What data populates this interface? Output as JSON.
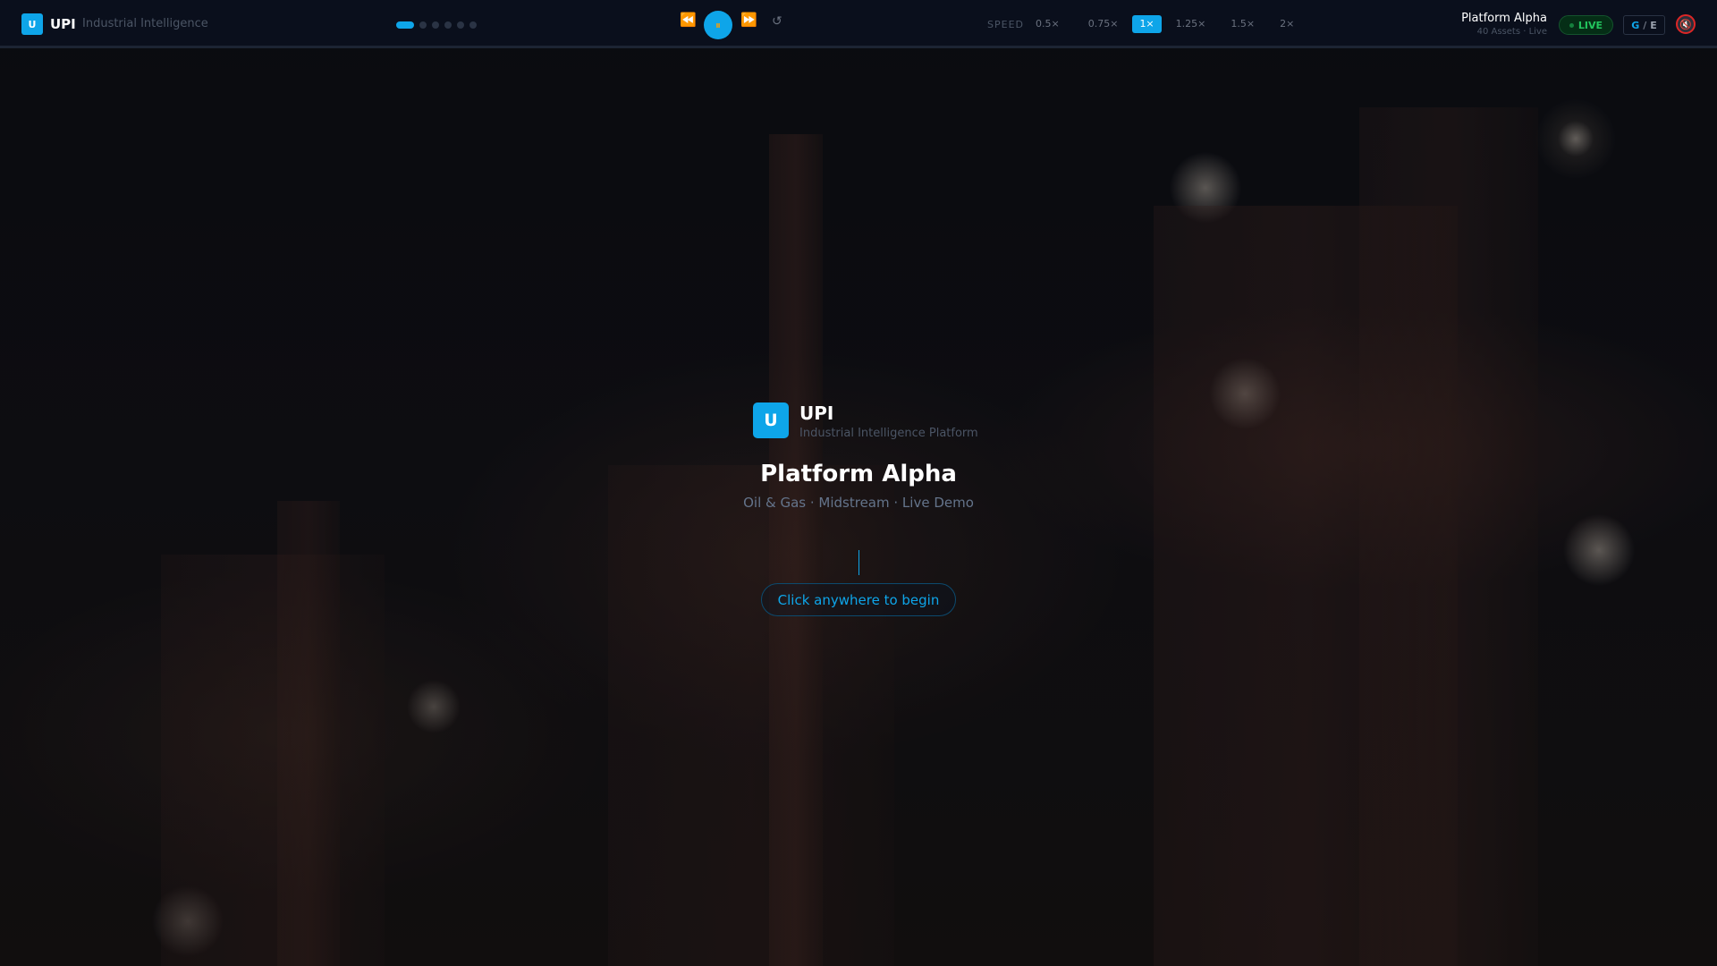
{
  "header": {
    "logo_letter": "U",
    "brand": "UPI",
    "subtitle": "Industrial Intelligence",
    "progress": {
      "total_steps": 6,
      "current_step": 1
    },
    "controls": {
      "rewind": "⏪",
      "pause": "⏸",
      "forward": "⏩",
      "restart": "↺"
    },
    "speed_label": "SPEED",
    "speeds": [
      "0.5×",
      "0.75×",
      "1×",
      "1.25×",
      "1.5×",
      "2×"
    ],
    "selected_speed": "1×",
    "platform_name": "Platform Alpha",
    "platform_meta": "40 Assets · Live",
    "live_badge": "LIVE",
    "lang_g": "G",
    "lang_sep": "/",
    "lang_e": "E",
    "mute_icon": "🔇"
  },
  "splash": {
    "logo_letter": "U",
    "brand": "UPI",
    "brand_sub": "Industrial Intelligence Platform",
    "title": "Platform Alpha",
    "tagline": "Oil & Gas · Midstream · Live Demo",
    "cta": "Click anywhere to begin"
  },
  "colors": {
    "accent": "#0ea5e9",
    "live": "#22c55e",
    "controls": "#f59e0b"
  }
}
